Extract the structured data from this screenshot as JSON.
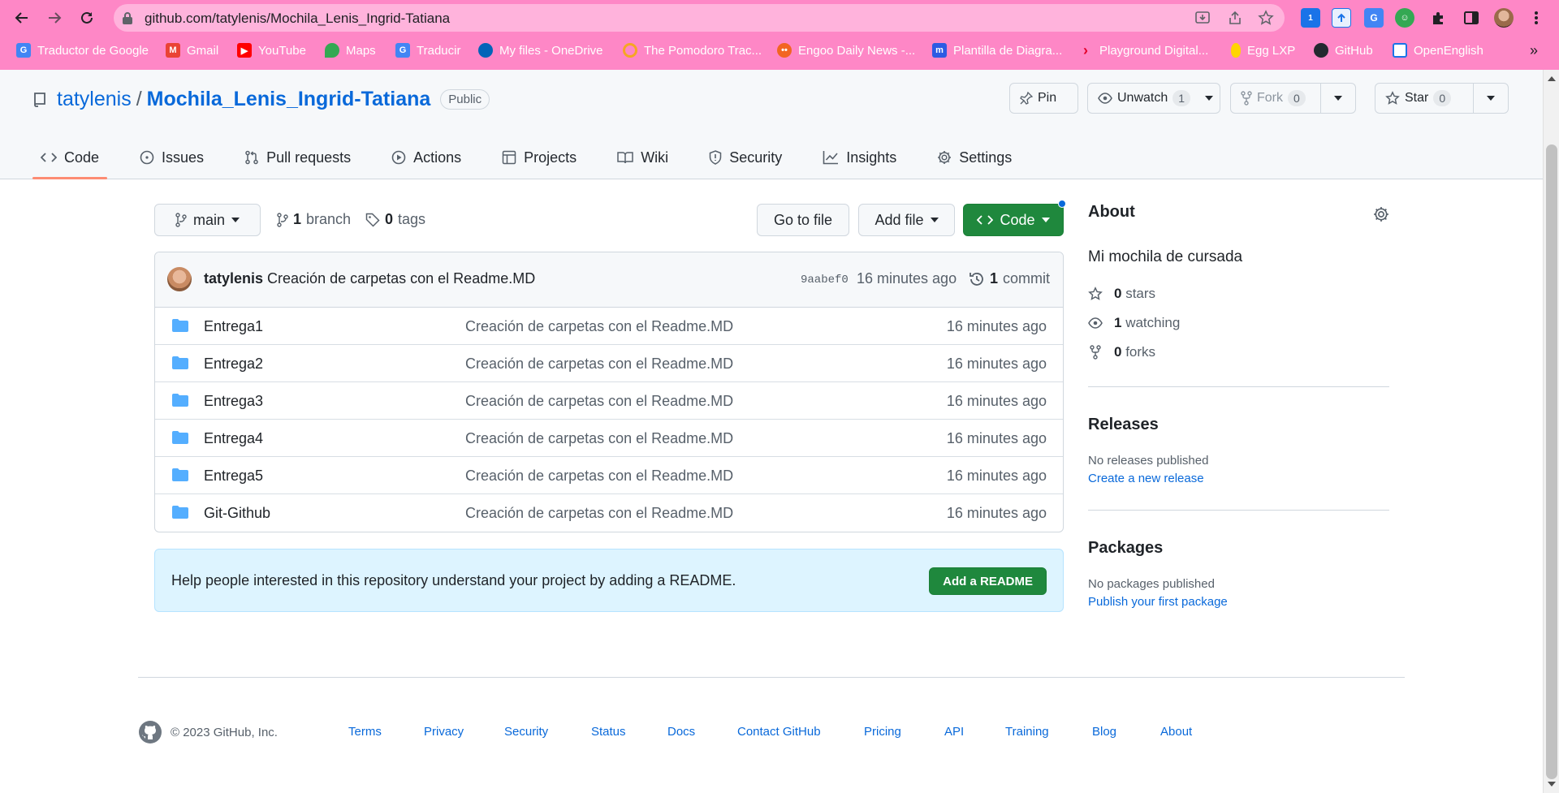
{
  "browser": {
    "url": "github.com/tatylenis/Mochila_Lenis_Ingrid-Tatiana",
    "bookmarks": [
      {
        "label": "Traductor de Google",
        "icon": "google-translate-icon",
        "color": "#4285f4"
      },
      {
        "label": "Gmail",
        "icon": "gmail-icon",
        "color": "#ea4335"
      },
      {
        "label": "YouTube",
        "icon": "youtube-icon",
        "color": "#ff0000"
      },
      {
        "label": "Maps",
        "icon": "maps-icon",
        "color": "#34a853"
      },
      {
        "label": "Traducir",
        "icon": "google-translate-icon",
        "color": "#4285f4"
      },
      {
        "label": "My files - OneDrive",
        "icon": "onedrive-icon",
        "color": "#0364b8"
      },
      {
        "label": "The Pomodoro Trac...",
        "icon": "pomodoro-icon",
        "color": "#f5a623"
      },
      {
        "label": "Engoo Daily News -...",
        "icon": "engoo-icon",
        "color": "#f26522"
      },
      {
        "label": "Plantilla de Diagra...",
        "icon": "miro-icon",
        "color": "#2d5be3"
      },
      {
        "label": "Playground Digital...",
        "icon": "playground-icon",
        "color": "#e4002b"
      },
      {
        "label": "Egg LXP",
        "icon": "egg-icon",
        "color": "#ffd400"
      },
      {
        "label": "GitHub",
        "icon": "github-icon",
        "color": "#24292f"
      },
      {
        "label": "OpenEnglish",
        "icon": "openenglish-icon",
        "color": "#1a73e8"
      }
    ],
    "more_bookmarks": "»",
    "ext_badge": "1"
  },
  "repo": {
    "owner": "tatylenis",
    "slash": "/",
    "name": "Mochila_Lenis_Ingrid-Tatiana",
    "visibility": "Public",
    "pin_label": "Pin",
    "unwatch_label": "Unwatch",
    "watch_count": "1",
    "fork_label": "Fork",
    "fork_count": "0",
    "star_label": "Star",
    "star_count": "0"
  },
  "tabs": [
    {
      "label": "Code",
      "icon": "code-icon",
      "active": true
    },
    {
      "label": "Issues",
      "icon": "issue-icon"
    },
    {
      "label": "Pull requests",
      "icon": "pull-request-icon"
    },
    {
      "label": "Actions",
      "icon": "play-icon"
    },
    {
      "label": "Projects",
      "icon": "table-icon"
    },
    {
      "label": "Wiki",
      "icon": "book-icon"
    },
    {
      "label": "Security",
      "icon": "shield-icon"
    },
    {
      "label": "Insights",
      "icon": "graph-icon"
    },
    {
      "label": "Settings",
      "icon": "gear-icon"
    }
  ],
  "file_nav": {
    "branch": "main",
    "branch_count": "1",
    "branch_word": "branch",
    "tag_count": "0",
    "tag_word": "tags",
    "go_to_file": "Go to file",
    "add_file": "Add file",
    "code": "Code"
  },
  "commit": {
    "author": "tatylenis",
    "message": "Creación de carpetas con el Readme.MD",
    "sha": "9aabef0",
    "age": "16 minutes ago",
    "count": "1",
    "count_word": "commit"
  },
  "files": [
    {
      "name": "Entrega1",
      "message": "Creación de carpetas con el Readme.MD",
      "age": "16 minutes ago"
    },
    {
      "name": "Entrega2",
      "message": "Creación de carpetas con el Readme.MD",
      "age": "16 minutes ago"
    },
    {
      "name": "Entrega3",
      "message": "Creación de carpetas con el Readme.MD",
      "age": "16 minutes ago"
    },
    {
      "name": "Entrega4",
      "message": "Creación de carpetas con el Readme.MD",
      "age": "16 minutes ago"
    },
    {
      "name": "Entrega5",
      "message": "Creación de carpetas con el Readme.MD",
      "age": "16 minutes ago"
    },
    {
      "name": "Git-Github",
      "message": "Creación de carpetas con el Readme.MD",
      "age": "16 minutes ago"
    }
  ],
  "readme_prompt": {
    "message": "Help people interested in this repository understand your project by adding a README.",
    "button": "Add a README"
  },
  "about": {
    "title": "About",
    "description": "Mi mochila de cursada",
    "stars_count": "0",
    "stars_word": "stars",
    "watching_count": "1",
    "watching_word": "watching",
    "forks_count": "0",
    "forks_word": "forks"
  },
  "releases": {
    "title": "Releases",
    "empty": "No releases published",
    "link": "Create a new release"
  },
  "packages": {
    "title": "Packages",
    "empty": "No packages published",
    "link": "Publish your first package"
  },
  "footer": {
    "copyright": "© 2023 GitHub, Inc.",
    "links": [
      "Terms",
      "Privacy",
      "Security",
      "Status",
      "Docs",
      "Contact GitHub",
      "Pricing",
      "API",
      "Training",
      "Blog",
      "About"
    ]
  },
  "colors": {
    "browser_frame": "#fe87c6",
    "link": "#0969da",
    "primary_button": "#1f883d",
    "active_tab_underline": "#fd8c73",
    "folder": "#54aeff",
    "readme_banner": "#ddf4ff"
  }
}
